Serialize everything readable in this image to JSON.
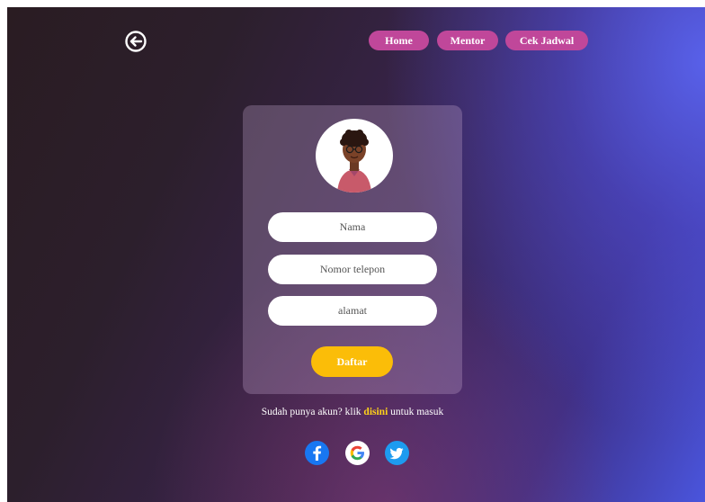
{
  "nav": {
    "home": "Home",
    "mentor": "Mentor",
    "schedule": "Cek Jadwal"
  },
  "form": {
    "name_placeholder": "Nama",
    "phone_placeholder": "Nomor telepon",
    "address_placeholder": "alamat",
    "submit_label": "Daftar"
  },
  "login": {
    "prefix": "Sudah punya akun? klik ",
    "link": "disini",
    "suffix": " untuk masuk"
  },
  "social": [
    "facebook-icon",
    "google-icon",
    "twitter-icon"
  ],
  "colors": {
    "nav_pill": "#c0479a",
    "submit": "#fbbd08",
    "link": "#ffd21a"
  }
}
